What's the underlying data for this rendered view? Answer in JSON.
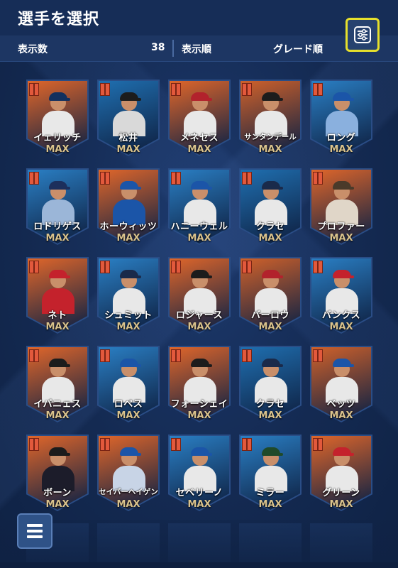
{
  "header": {
    "title": "選手を選択"
  },
  "toolbar": {
    "display_count_label": "表示数",
    "display_count_value": "38",
    "sort_label": "表示順",
    "sort_value": "グレード順",
    "filter_icon": "sliders-icon"
  },
  "players": [
    {
      "name": "イェリッチ",
      "level": "MAX",
      "bg": "#e0662a",
      "cap": "#12305e",
      "body": "#e8e8e8"
    },
    {
      "name": "松井",
      "level": "MAX",
      "bg": "#1f6fb0",
      "cap": "#1c1c1c",
      "body": "#d9d9d9"
    },
    {
      "name": "メネセス",
      "level": "MAX",
      "bg": "#e0662a",
      "cap": "#b2222c",
      "body": "#e8e8e8"
    },
    {
      "name": "サンタンデール",
      "level": "MAX",
      "bg": "#d0612a",
      "cap": "#1c1c1c",
      "body": "#e8e8e8"
    },
    {
      "name": "ロング",
      "level": "MAX",
      "bg": "#2a7fc4",
      "cap": "#1b55a8",
      "body": "#8ab0de"
    },
    {
      "name": "ロドリゲス",
      "level": "MAX",
      "bg": "#2a7fc4",
      "cap": "#1c2f5c",
      "body": "#9bb6d8"
    },
    {
      "name": "ホーウィッツ",
      "level": "MAX",
      "bg": "#e0662a",
      "cap": "#1b55a8",
      "body": "#1b55a8"
    },
    {
      "name": "ハニーウェル",
      "level": "MAX",
      "bg": "#2a7fc4",
      "cap": "#1b55a8",
      "body": "#e8e8e8"
    },
    {
      "name": "クラセ",
      "level": "MAX",
      "bg": "#1f6fb0",
      "cap": "#1a2a4a",
      "body": "#e8e8e8"
    },
    {
      "name": "プロファー",
      "level": "MAX",
      "bg": "#e0662a",
      "cap": "#4a3a2a",
      "body": "#e0d6c8"
    },
    {
      "name": "ネト",
      "level": "MAX",
      "bg": "#e0662a",
      "cap": "#c4222c",
      "body": "#c4222c"
    },
    {
      "name": "シュミット",
      "level": "MAX",
      "bg": "#2a7fc4",
      "cap": "#1a2a4a",
      "body": "#e8e8e8"
    },
    {
      "name": "ロジャース",
      "level": "MAX",
      "bg": "#e0662a",
      "cap": "#1c1c1c",
      "body": "#e8e8e8"
    },
    {
      "name": "バーロウ",
      "level": "MAX",
      "bg": "#d0612a",
      "cap": "#b2222c",
      "body": "#e8e8e8"
    },
    {
      "name": "バンクス",
      "level": "MAX",
      "bg": "#2a7fc4",
      "cap": "#c4222c",
      "body": "#e8e8e8"
    },
    {
      "name": "イバニェス",
      "level": "MAX",
      "bg": "#e0662a",
      "cap": "#1c1c1c",
      "body": "#e8e8e8"
    },
    {
      "name": "ロペス",
      "level": "MAX",
      "bg": "#2a7fc4",
      "cap": "#1b55a8",
      "body": "#e8e8e8"
    },
    {
      "name": "フォーシェイ",
      "level": "MAX",
      "bg": "#e0662a",
      "cap": "#1c1c1c",
      "body": "#e8e8e8"
    },
    {
      "name": "クラセ",
      "level": "MAX",
      "bg": "#1f6fb0",
      "cap": "#1a2a4a",
      "body": "#e8e8e8"
    },
    {
      "name": "ベッツ",
      "level": "MAX",
      "bg": "#d0612a",
      "cap": "#1b55a8",
      "body": "#e8e8e8"
    },
    {
      "name": "ボーン",
      "level": "MAX",
      "bg": "#e0662a",
      "cap": "#1c1c1c",
      "body": "#1c1c2a"
    },
    {
      "name": "セイバーヘイゲン",
      "level": "MAX",
      "bg": "#e0662a",
      "cap": "#1b55a8",
      "body": "#c8d4e6"
    },
    {
      "name": "セベリーノ",
      "level": "MAX",
      "bg": "#2a7fc4",
      "cap": "#1b55a8",
      "body": "#e8e8e8"
    },
    {
      "name": "ミラー",
      "level": "MAX",
      "bg": "#2a7fc4",
      "cap": "#1f4a2a",
      "body": "#e8e8e8"
    },
    {
      "name": "グリーン",
      "level": "MAX",
      "bg": "#e0662a",
      "cap": "#c4222c",
      "body": "#e8e8e8"
    }
  ],
  "menu": {
    "icon": "menu-icon"
  }
}
